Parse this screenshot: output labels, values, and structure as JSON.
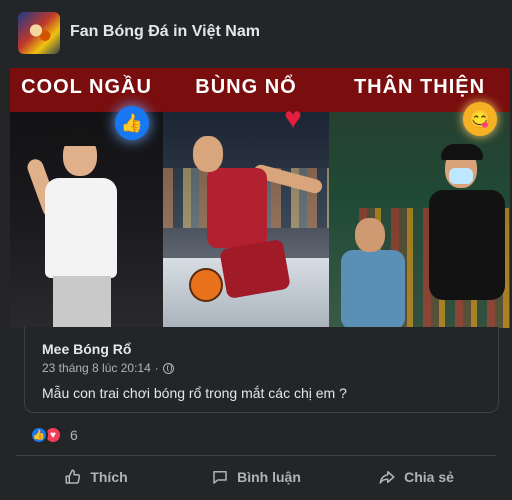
{
  "group": {
    "name": "Fan Bóng Đá in Việt Nam"
  },
  "panels": [
    {
      "title": "COOL NGẦU",
      "reaction": "like-icon"
    },
    {
      "title": "BÙNG NỔ",
      "reaction": "heart-icon"
    },
    {
      "title": "THÂN THIỆN",
      "reaction": "haha-icon"
    }
  ],
  "shared_post": {
    "author": "Mee Bóng Rổ",
    "timestamp": "23 tháng 8 lúc 20:14",
    "separator": "·",
    "text": "Mẫu con trai chơi bóng rổ trong mắt các chị em ?"
  },
  "reactions": {
    "count": "6"
  },
  "actions": {
    "like_label": "Thích",
    "comment_label": "Bình luận",
    "share_label": "Chia sẻ"
  },
  "colors": {
    "background": "#242526",
    "text_primary": "#e4e6eb",
    "text_secondary": "#b0b3b8",
    "like_blue": "#1877f2",
    "love_red": "#f33e58",
    "banner_red": "#7a0d0d"
  }
}
